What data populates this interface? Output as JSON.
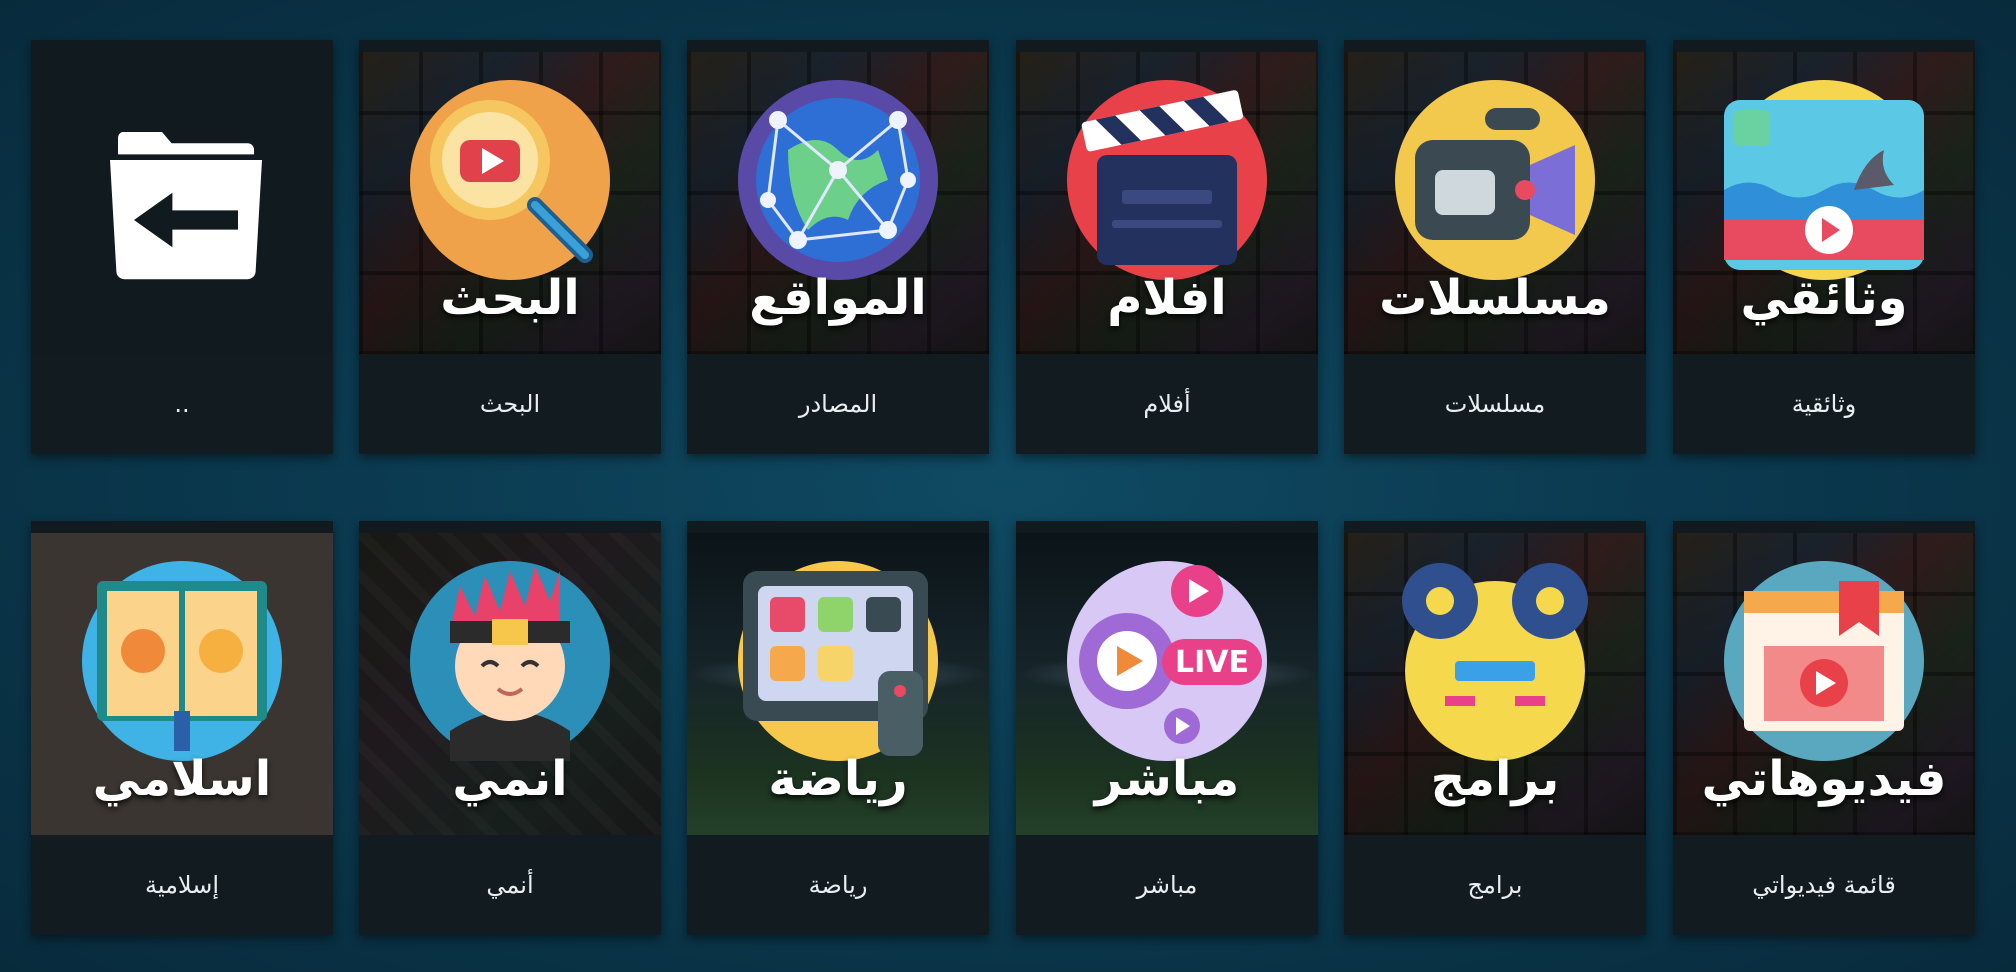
{
  "row1": [
    {
      "name": "back",
      "label": "..",
      "icon": "folder-back-icon"
    },
    {
      "name": "search",
      "title": "البحث",
      "label": "البحث",
      "icon": "youtube-search-icon"
    },
    {
      "name": "sites",
      "title": "المواقع",
      "label": "المصادر",
      "icon": "globe-network-icon"
    },
    {
      "name": "movies",
      "title": "افلام",
      "label": "أفلام",
      "icon": "clapperboard-icon"
    },
    {
      "name": "series",
      "title": "مسلسلات",
      "label": "مسلسلات",
      "icon": "video-camera-icon"
    },
    {
      "name": "documentary",
      "title": "وثائقي",
      "label": "وثائقية",
      "icon": "nature-video-icon"
    }
  ],
  "row2": [
    {
      "name": "islamic",
      "title": "اسلامي",
      "label": "إسلامية",
      "icon": "quran-book-icon"
    },
    {
      "name": "anime",
      "title": "انمي",
      "label": "أنمي",
      "icon": "anime-character-icon"
    },
    {
      "name": "sports",
      "title": "رياضة",
      "label": "رياضة",
      "icon": "sports-tv-icon"
    },
    {
      "name": "live",
      "title": "مباشر",
      "label": "مباشر",
      "icon": "live-stream-icon"
    },
    {
      "name": "programs",
      "title": "برامج",
      "label": "برامج",
      "icon": "film-projector-icon"
    },
    {
      "name": "videos",
      "title": "فيديوهاتي",
      "label": "قائمة فيديواتي",
      "icon": "video-bookmark-icon"
    }
  ]
}
